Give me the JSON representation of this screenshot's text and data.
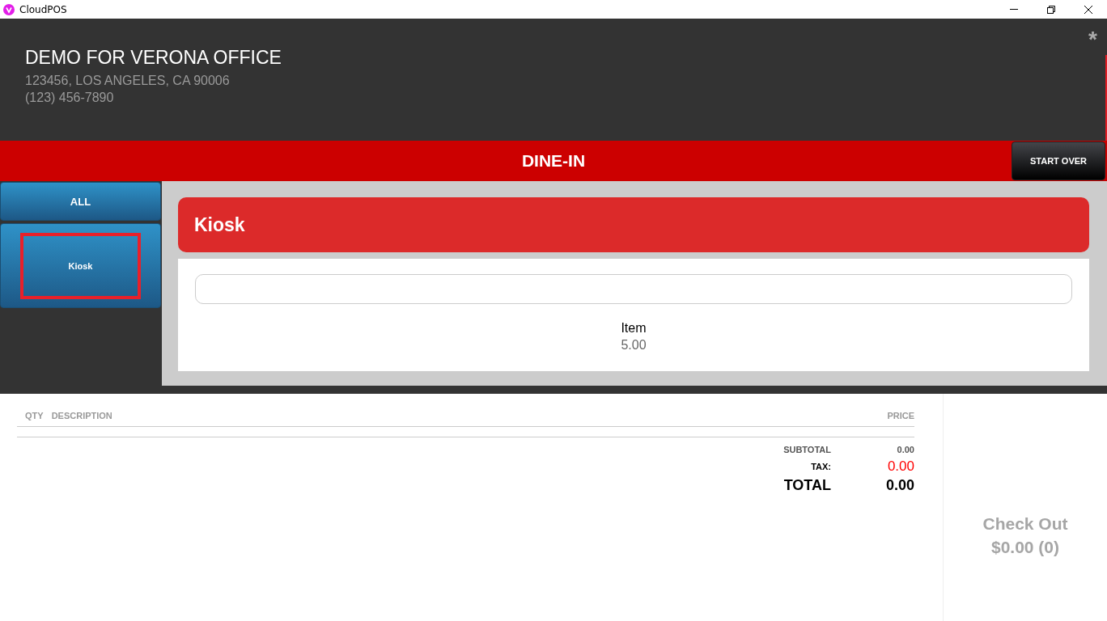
{
  "window": {
    "title": "CloudPOS"
  },
  "header": {
    "store_name": "DEMO FOR VERONA OFFICE",
    "address": "123456, LOS ANGELES, CA 90006",
    "phone": "(123) 456-7890",
    "badge": "*"
  },
  "order_bar": {
    "mode": "DINE-IN",
    "start_over": "START OVER"
  },
  "categories": [
    {
      "label": "ALL",
      "selected": false
    },
    {
      "label": "Kiosk",
      "selected": true
    }
  ],
  "menu": {
    "title": "Kiosk",
    "items": [
      {
        "name": "Item",
        "price": "5.00"
      }
    ]
  },
  "order": {
    "columns": [
      "QTY",
      "DESCRIPTION",
      "PRICE"
    ],
    "totals": [
      {
        "kind": "subtotal",
        "label": "SUBTOTAL",
        "value": "0.00"
      },
      {
        "kind": "tax",
        "label": "TAX:",
        "value": "0.00"
      },
      {
        "kind": "total",
        "label": "TOTAL",
        "value": "0.00"
      }
    ]
  },
  "checkout": {
    "label": "Check Out",
    "amount": "$0.00 (0)",
    "disabled": true
  }
}
